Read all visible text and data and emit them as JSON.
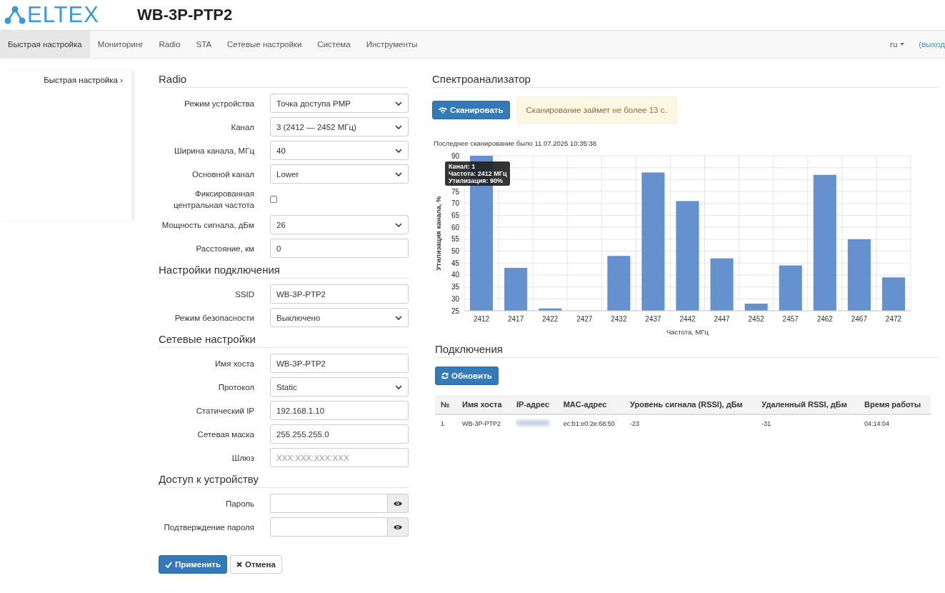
{
  "header": {
    "logo": "ELTEX",
    "title": "WB-3P-PTP2"
  },
  "nav": {
    "tabs": [
      {
        "label": "Быстрая настройка",
        "selected": true
      },
      {
        "label": "Мониторинг",
        "selected": false
      },
      {
        "label": "Radio",
        "selected": false
      },
      {
        "label": "STA",
        "selected": false
      },
      {
        "label": "Сетевые настройки",
        "selected": false
      },
      {
        "label": "Система",
        "selected": false
      },
      {
        "label": "Инструменты",
        "selected": false
      }
    ],
    "language": "ru",
    "logout": "(выход"
  },
  "sidebar": {
    "items": [
      {
        "label": "Быстрая настройка ›",
        "selected": true
      }
    ]
  },
  "form": {
    "sections": [
      {
        "title": "Radio",
        "fields": [
          {
            "kind": "select",
            "label": "Режим устройства",
            "value": "Точка доступа PMP"
          },
          {
            "kind": "select",
            "label": "Канал",
            "value": "3 (2412 — 2452 МГц)"
          },
          {
            "kind": "select",
            "label": "Ширина канала, МГц",
            "value": "40"
          },
          {
            "kind": "select",
            "label": "Основной канал",
            "value": "Lower"
          },
          {
            "kind": "checkbox",
            "label": "Фиксированная центральная частота",
            "checked": false
          },
          {
            "kind": "select",
            "label": "Мощность сигнала, дБм",
            "value": "26"
          },
          {
            "kind": "text",
            "label": "Расстояние, км",
            "value": "0"
          }
        ]
      },
      {
        "title": "Настройки подключения",
        "fields": [
          {
            "kind": "text",
            "label": "SSID",
            "value": "WB-3P-PTP2"
          },
          {
            "kind": "select",
            "label": "Режим безопасности",
            "value": "Выключено"
          }
        ]
      },
      {
        "title": "Сетевые настройки",
        "fields": [
          {
            "kind": "text",
            "label": "Имя хоста",
            "value": "WB-3P-PTP2"
          },
          {
            "kind": "select",
            "label": "Протокол",
            "value": "Static"
          },
          {
            "kind": "text",
            "label": "Статический IP",
            "value": "192.168.1.10"
          },
          {
            "kind": "text",
            "label": "Сетевая маска",
            "value": "255.255.255.0"
          },
          {
            "kind": "text",
            "label": "Шлюз",
            "placeholder": "XXX:XXX:XXX:XXX"
          }
        ]
      },
      {
        "title": "Доступ к устройству",
        "fields": [
          {
            "kind": "password",
            "label": "Пароль"
          },
          {
            "kind": "password",
            "label": "Подтверждение пароля"
          }
        ]
      }
    ],
    "buttons": [
      {
        "kind": "primary",
        "label": "Применить"
      },
      {
        "kind": "default",
        "label": "Отмена"
      }
    ]
  },
  "spectrum": {
    "title": "Спектроанализатор",
    "scan_button": "Сканировать",
    "notice": "Сканирование займет не более 13 с.",
    "last_scan": "Последнее сканирование было 11.07.2025 10:35:38",
    "chart_data": {
      "type": "bar",
      "xlabel": "Частота, МГц",
      "ylabel": "Утилизация канала, %",
      "categories": [
        "2412",
        "2417",
        "2422",
        "2427",
        "2432",
        "2437",
        "2442",
        "2447",
        "2452",
        "2457",
        "2462",
        "2467",
        "2472"
      ],
      "grid": true,
      "series": [
        {
          "color": "#6591cf",
          "values": [
            90,
            43,
            26,
            25,
            48,
            83,
            71,
            47,
            28,
            44,
            82,
            55,
            39
          ]
        }
      ],
      "ylim": [
        25,
        90
      ],
      "yticks": [
        25,
        30,
        35,
        40,
        45,
        50,
        55,
        60,
        65,
        70,
        75,
        90
      ]
    },
    "tooltip": [
      "Канал: 1",
      "Частота: 2412 МГц",
      "Утилизация: 90%"
    ]
  },
  "connections": {
    "title": "Подключения",
    "refresh_button": "Обновить",
    "table": {
      "columns": [
        "№",
        "Имя хоста",
        "IP-адрес",
        "MAC-адрес",
        "Уровень сигнала (RSSI), дБм",
        "Удаленный RSSI, дБм",
        "Время работы"
      ],
      "rows": [
        {
          "cells": [
            "1",
            "WB-3P-PTP2",
            null,
            "ec:b1:e0:2e:68:50",
            "-23",
            "-31",
            "04:14:04"
          ],
          "ip_blurred": true
        }
      ]
    }
  }
}
